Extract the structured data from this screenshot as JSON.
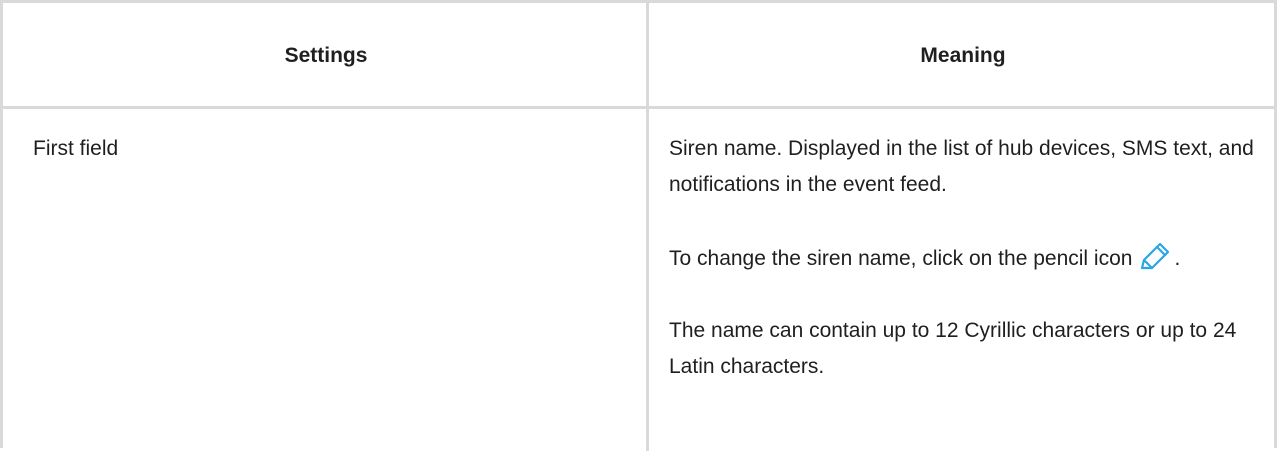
{
  "table": {
    "headers": {
      "settings": "Settings",
      "meaning": "Meaning"
    },
    "rows": [
      {
        "setting": "First field",
        "meaning": {
          "paragraph1": "Siren name. Displayed in the list of hub devices, SMS text, and notifications in the event feed.",
          "paragraph2_before_icon": "To change the siren name, click on the pencil icon",
          "paragraph2_after_icon": ".",
          "paragraph3": "The name can contain up to 12 Cyrillic characters or up to 24 Latin characters."
        }
      }
    ]
  },
  "colors": {
    "border": "#d9d9d9",
    "text": "#1f1f1f",
    "icon": "#2aa6e8"
  },
  "icons": {
    "pencil": "pencil-icon"
  }
}
